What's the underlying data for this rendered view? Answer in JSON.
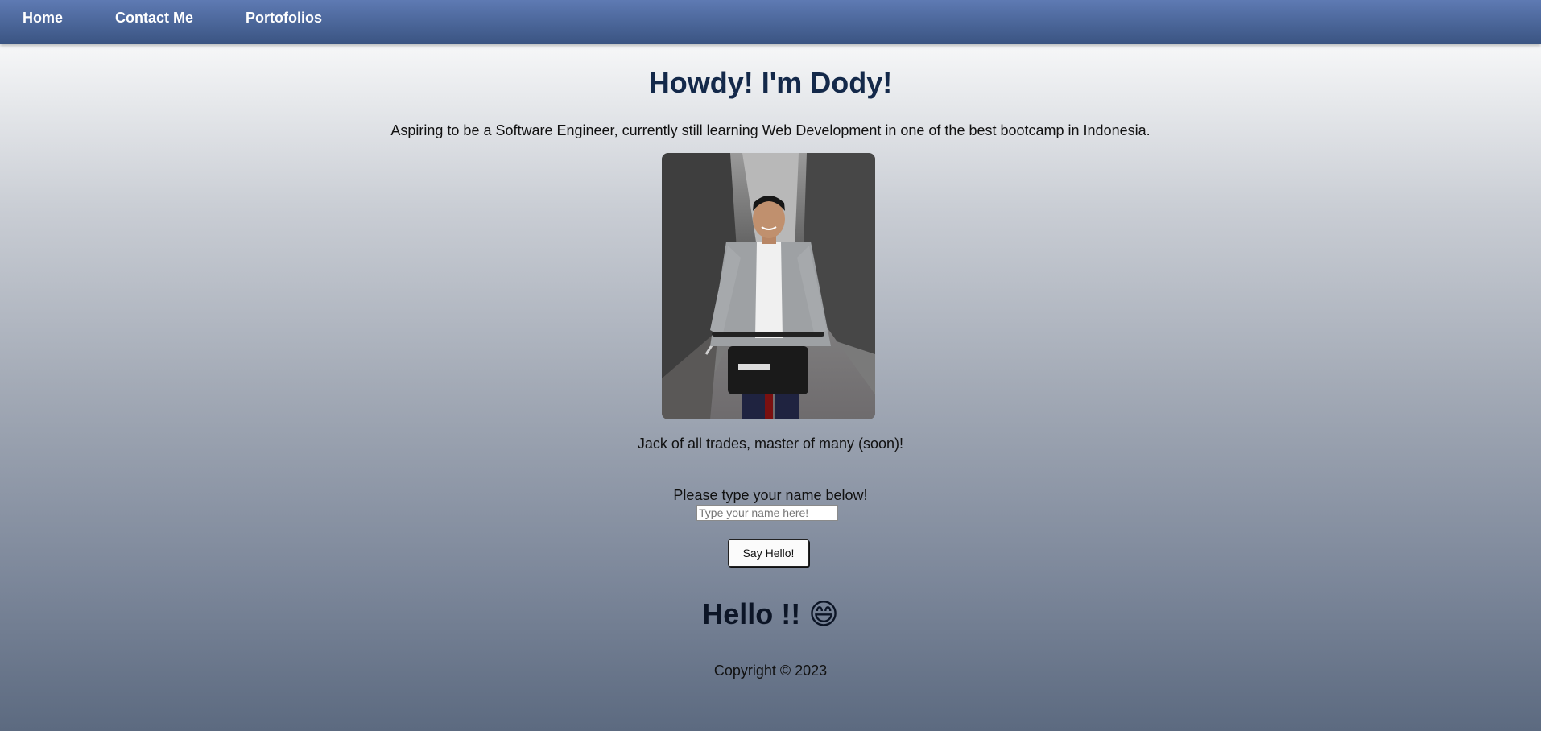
{
  "nav": {
    "items": [
      {
        "label": "Home"
      },
      {
        "label": "Contact Me"
      },
      {
        "label": "Portofolios"
      }
    ]
  },
  "hero": {
    "title": "Howdy! I'm Dody!",
    "tagline": "Aspiring to be a Software Engineer, currently still learning Web Development in one of the best bootcamp in Indonesia.",
    "caption": "Jack of all trades, master of many (soon)!"
  },
  "greeting_form": {
    "prompt": "Please type your name below!",
    "input_placeholder": "Type your name here!",
    "input_value": "",
    "button_label": "Say Hello!",
    "output": "Hello !! 😄"
  },
  "footer": {
    "copyright": "Copyright © 2023"
  }
}
